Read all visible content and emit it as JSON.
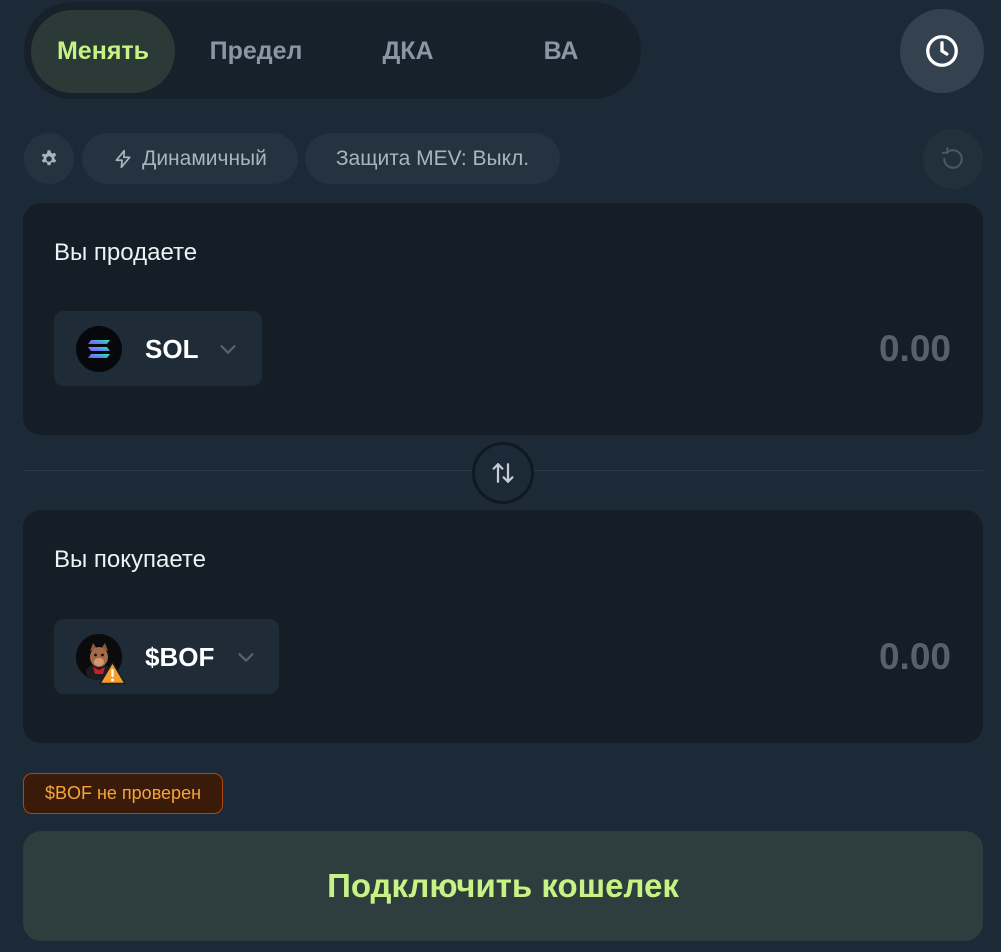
{
  "tabs": [
    {
      "label": "Менять",
      "active": true
    },
    {
      "label": "Предел",
      "active": false
    },
    {
      "label": "ДКА",
      "active": false
    },
    {
      "label": "ВА",
      "active": false
    }
  ],
  "history_icon": "clock-icon",
  "settings": {
    "gear_icon": "gear-icon",
    "dynamic_label": "Динамичный",
    "dynamic_icon": "lightning-icon",
    "mev_label": "Защита MEV: Выкл.",
    "refresh_icon": "refresh-icon"
  },
  "sell": {
    "title": "Вы продаете",
    "token": "SOL",
    "token_icon": "solana-logo-icon",
    "amount": "0.00"
  },
  "switch_icon": "swap-arrows-icon",
  "buy": {
    "title": "Вы покупаете",
    "token": "$BOF",
    "token_icon": "bof-token-icon",
    "warning_icon": "warning-icon",
    "amount": "0.00"
  },
  "warning": {
    "text": "$BOF не проверен"
  },
  "connect_button": {
    "label": "Подключить кошелек"
  },
  "colors": {
    "background": "#1c2936",
    "card": "#151e27",
    "accent": "#c7f284",
    "warning_text": "#f5a63a",
    "warning_border": "#b0480e"
  }
}
